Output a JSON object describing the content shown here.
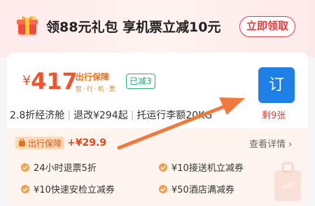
{
  "banner": {
    "text": "领88元礼包 享机票立减10元",
    "button_label": "立即领取",
    "icon": "gift-box-icon"
  },
  "ticket": {
    "currency": "¥",
    "price": "417",
    "protect_title": "出行保障",
    "protect_sub": "智·行·机·票",
    "discount_tag": "已减3",
    "discount_label": "2.8折经济舱",
    "refund_info": "退改¥294起",
    "baggage_info": "托运行李额20KG",
    "book_label": "订",
    "remaining": "剩9张"
  },
  "benefits": {
    "plan_label": "出行保障",
    "plan_price": "+¥29.9",
    "details_label": "查看详情",
    "items": [
      "24小时退票5折",
      "¥10接送机立减券",
      "¥10快速安检立减券",
      "¥50酒店满减券"
    ]
  },
  "colors": {
    "accent_red": "#e23b3b",
    "price_orange": "#f0542c",
    "book_blue": "#1e7fe6",
    "save_green": "#1aa66c",
    "arrow_orange": "#f07a3c"
  }
}
